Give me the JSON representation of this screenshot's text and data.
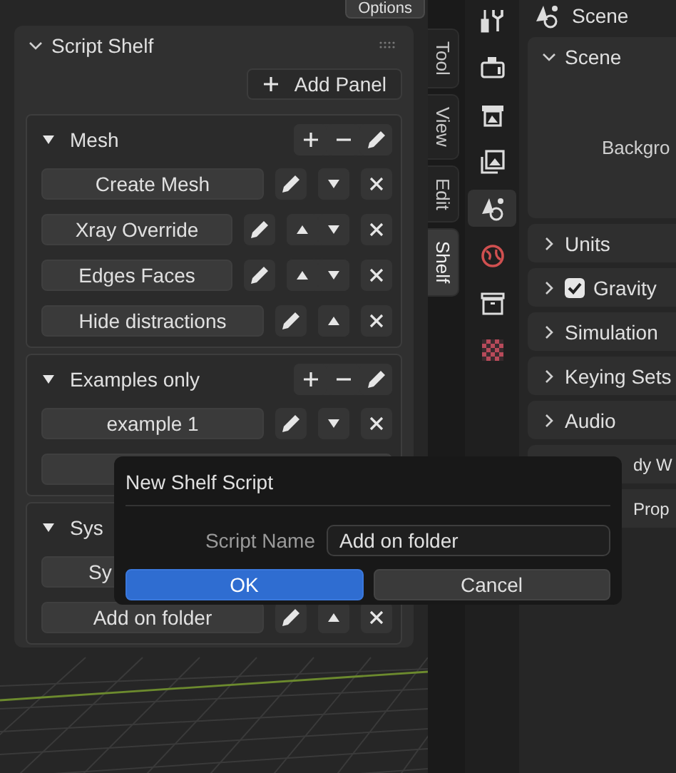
{
  "top_button": {
    "label": "Options"
  },
  "shelf": {
    "title": "Script Shelf",
    "expanded": true,
    "add_button": "Add Panel",
    "panels": [
      {
        "title": "Mesh",
        "expanded": true,
        "tools": true,
        "scripts": [
          {
            "kind": "normal",
            "label": "Create Mesh",
            "up": false,
            "down": true
          },
          {
            "kind": "normal",
            "label": "Xray Override",
            "up": true,
            "down": true
          },
          {
            "kind": "normal",
            "label": "Edges Faces",
            "up": true,
            "down": true
          },
          {
            "kind": "normal",
            "label": "Hide distractions",
            "up": true,
            "down": false
          }
        ]
      },
      {
        "title": "Examples only",
        "expanded": true,
        "tools": true,
        "scripts": [
          {
            "kind": "normal",
            "label": "example 1",
            "up": false,
            "down": true
          },
          {
            "kind": "covered"
          }
        ]
      },
      {
        "title": "Sys",
        "expanded": true,
        "tools": false,
        "scripts": [
          {
            "kind": "covered",
            "label": "Sy"
          },
          {
            "kind": "normal",
            "label": "Add on folder",
            "up": true,
            "down": false
          }
        ]
      }
    ]
  },
  "side_tabs": [
    {
      "label": "Tool",
      "selected": false
    },
    {
      "label": "View",
      "selected": false
    },
    {
      "label": "Edit",
      "selected": false
    },
    {
      "label": "Shelf",
      "selected": true
    }
  ],
  "property_tabs": [
    {
      "selected": false
    },
    {
      "selected": false
    },
    {
      "selected": false
    },
    {
      "selected": false
    },
    {
      "selected": true
    },
    {
      "selected": false
    },
    {
      "selected": false
    },
    {
      "selected": false
    }
  ],
  "properties": {
    "header": "Scene",
    "panels": [
      {
        "kind": "plain",
        "title": "Scene",
        "expanded": true,
        "content": [
          "Backgro"
        ]
      },
      {
        "kind": "plain",
        "title": "Units",
        "expanded": false
      },
      {
        "kind": "checkbox",
        "title": "Gravity",
        "expanded": false,
        "checked": true
      },
      {
        "kind": "plain",
        "title": "Simulation",
        "expanded": false
      },
      {
        "kind": "plain",
        "title": "Keying Sets",
        "expanded": false
      },
      {
        "kind": "plain",
        "title": "Audio",
        "expanded": false
      },
      {
        "kind": "covered",
        "title": "dy W"
      },
      {
        "kind": "covered",
        "title": "Prop"
      }
    ]
  },
  "dialog": {
    "title": "New Shelf Script",
    "field_label": "Script Name",
    "value": "Add on folder",
    "buttons": [
      {
        "label": "OK",
        "selected": true
      },
      {
        "label": "Cancel",
        "selected": false
      }
    ]
  }
}
